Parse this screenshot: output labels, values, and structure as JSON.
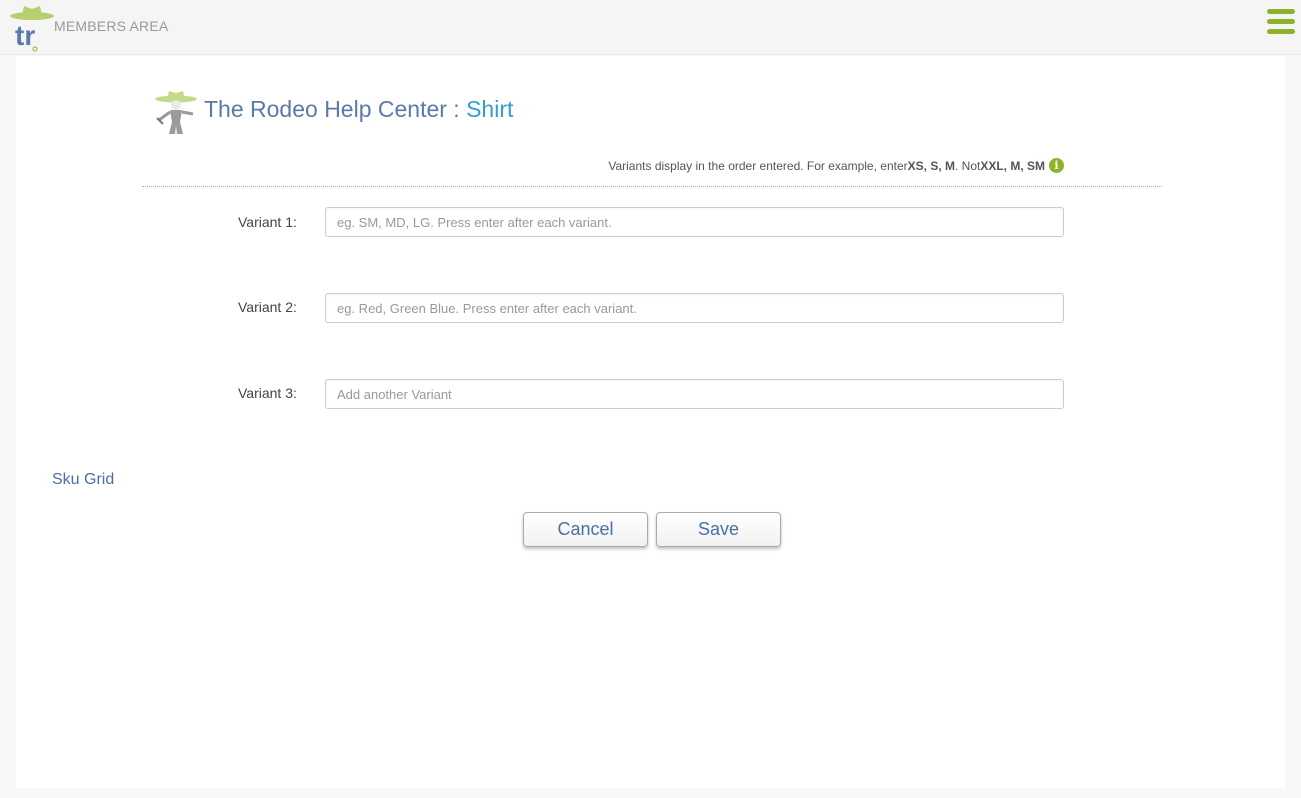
{
  "topbar": {
    "logo_text": "tr",
    "members_label": "MEMBERS AREA",
    "menu_icon": "hamburger-menu-icon",
    "accent_color": "#8db32b"
  },
  "header": {
    "title": "The Rodeo Help Center",
    "separator": " : ",
    "subtitle": "Shirt",
    "icon": "cowboy-mascot-icon"
  },
  "hint": {
    "prefix": "Variants display in the order entered. For example, enter ",
    "good_example": "XS, S, M",
    "middle": ". Not ",
    "bad_example": "XXL, M, SM",
    "icon": "info-icon"
  },
  "variants": [
    {
      "label": "Variant 1:",
      "value": "",
      "placeholder": "eg. SM, MD, LG. Press enter after each variant."
    },
    {
      "label": "Variant 2:",
      "value": "",
      "placeholder": "eg. Red, Green Blue. Press enter after each variant."
    },
    {
      "label": "Variant 3:",
      "value": "",
      "placeholder": "Add another Variant"
    }
  ],
  "sku_grid_label": "Sku Grid",
  "buttons": {
    "cancel": "Cancel",
    "save": "Save"
  }
}
